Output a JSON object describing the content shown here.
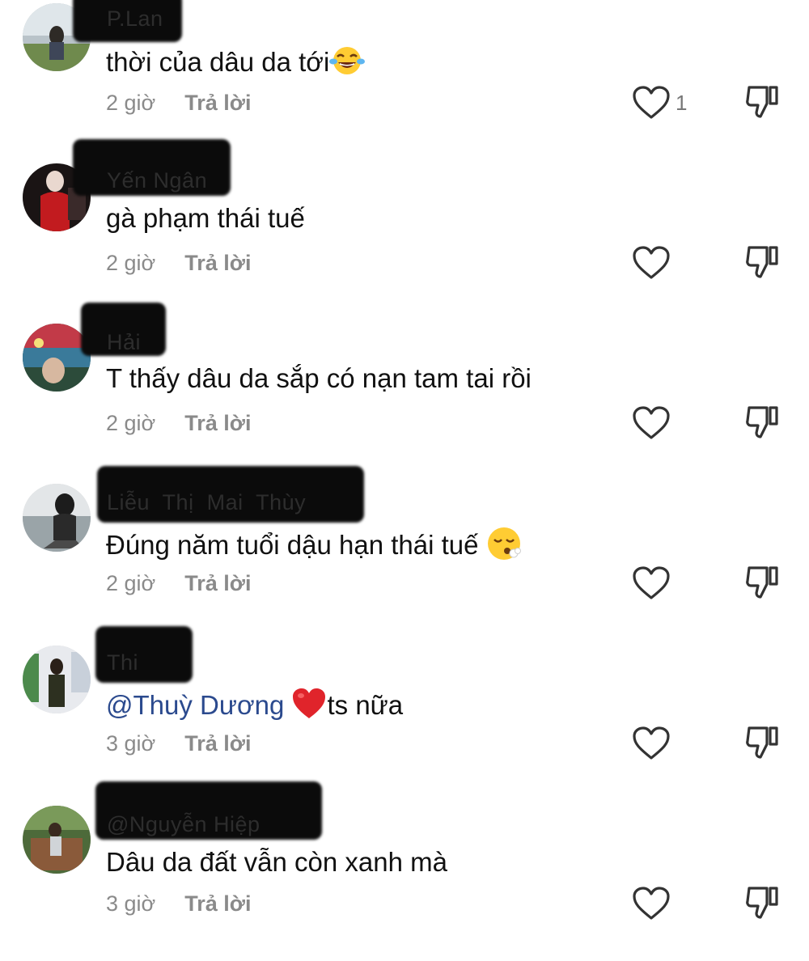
{
  "comments": [
    {
      "username": "P.Lan",
      "text": "thời của dâu da tới",
      "emoji": "laughing-tears-emoji",
      "time": "2 giờ",
      "reply_label": "Trả lời",
      "like_count": "1"
    },
    {
      "username": "Yến Ngân",
      "text": "gà phạm thái tuế",
      "time": "2 giờ",
      "reply_label": "Trả lời"
    },
    {
      "username": "Hải",
      "text": "T thấy dâu da sắp có nạn tam tai rồi",
      "time": "2 giờ",
      "reply_label": "Trả lời"
    },
    {
      "username": "Liễu  Thị  Mai  Thùy",
      "text": "Đúng năm tuổi dậu hạn thái tuế",
      "emoji": "sighing-face-emoji",
      "time": "2 giờ",
      "reply_label": "Trả lời"
    },
    {
      "username": "Thi",
      "mention": "@Thuỳ Dương",
      "emoji": "red-heart-emoji",
      "text": "ts nữa",
      "time": "3 giờ",
      "reply_label": "Trả lời"
    },
    {
      "username": "@Nguyễn Hiệp",
      "text": "Dâu da đất vẫn còn xanh mà",
      "time": "3 giờ",
      "reply_label": "Trả lời"
    }
  ],
  "icons": {
    "like": "heart-outline-icon",
    "dislike": "thumbs-down-outline-icon"
  },
  "colors": {
    "mention": "#2b4a8e",
    "meta_gray": "#8a8a8a",
    "heart_red": "#e0242b"
  }
}
